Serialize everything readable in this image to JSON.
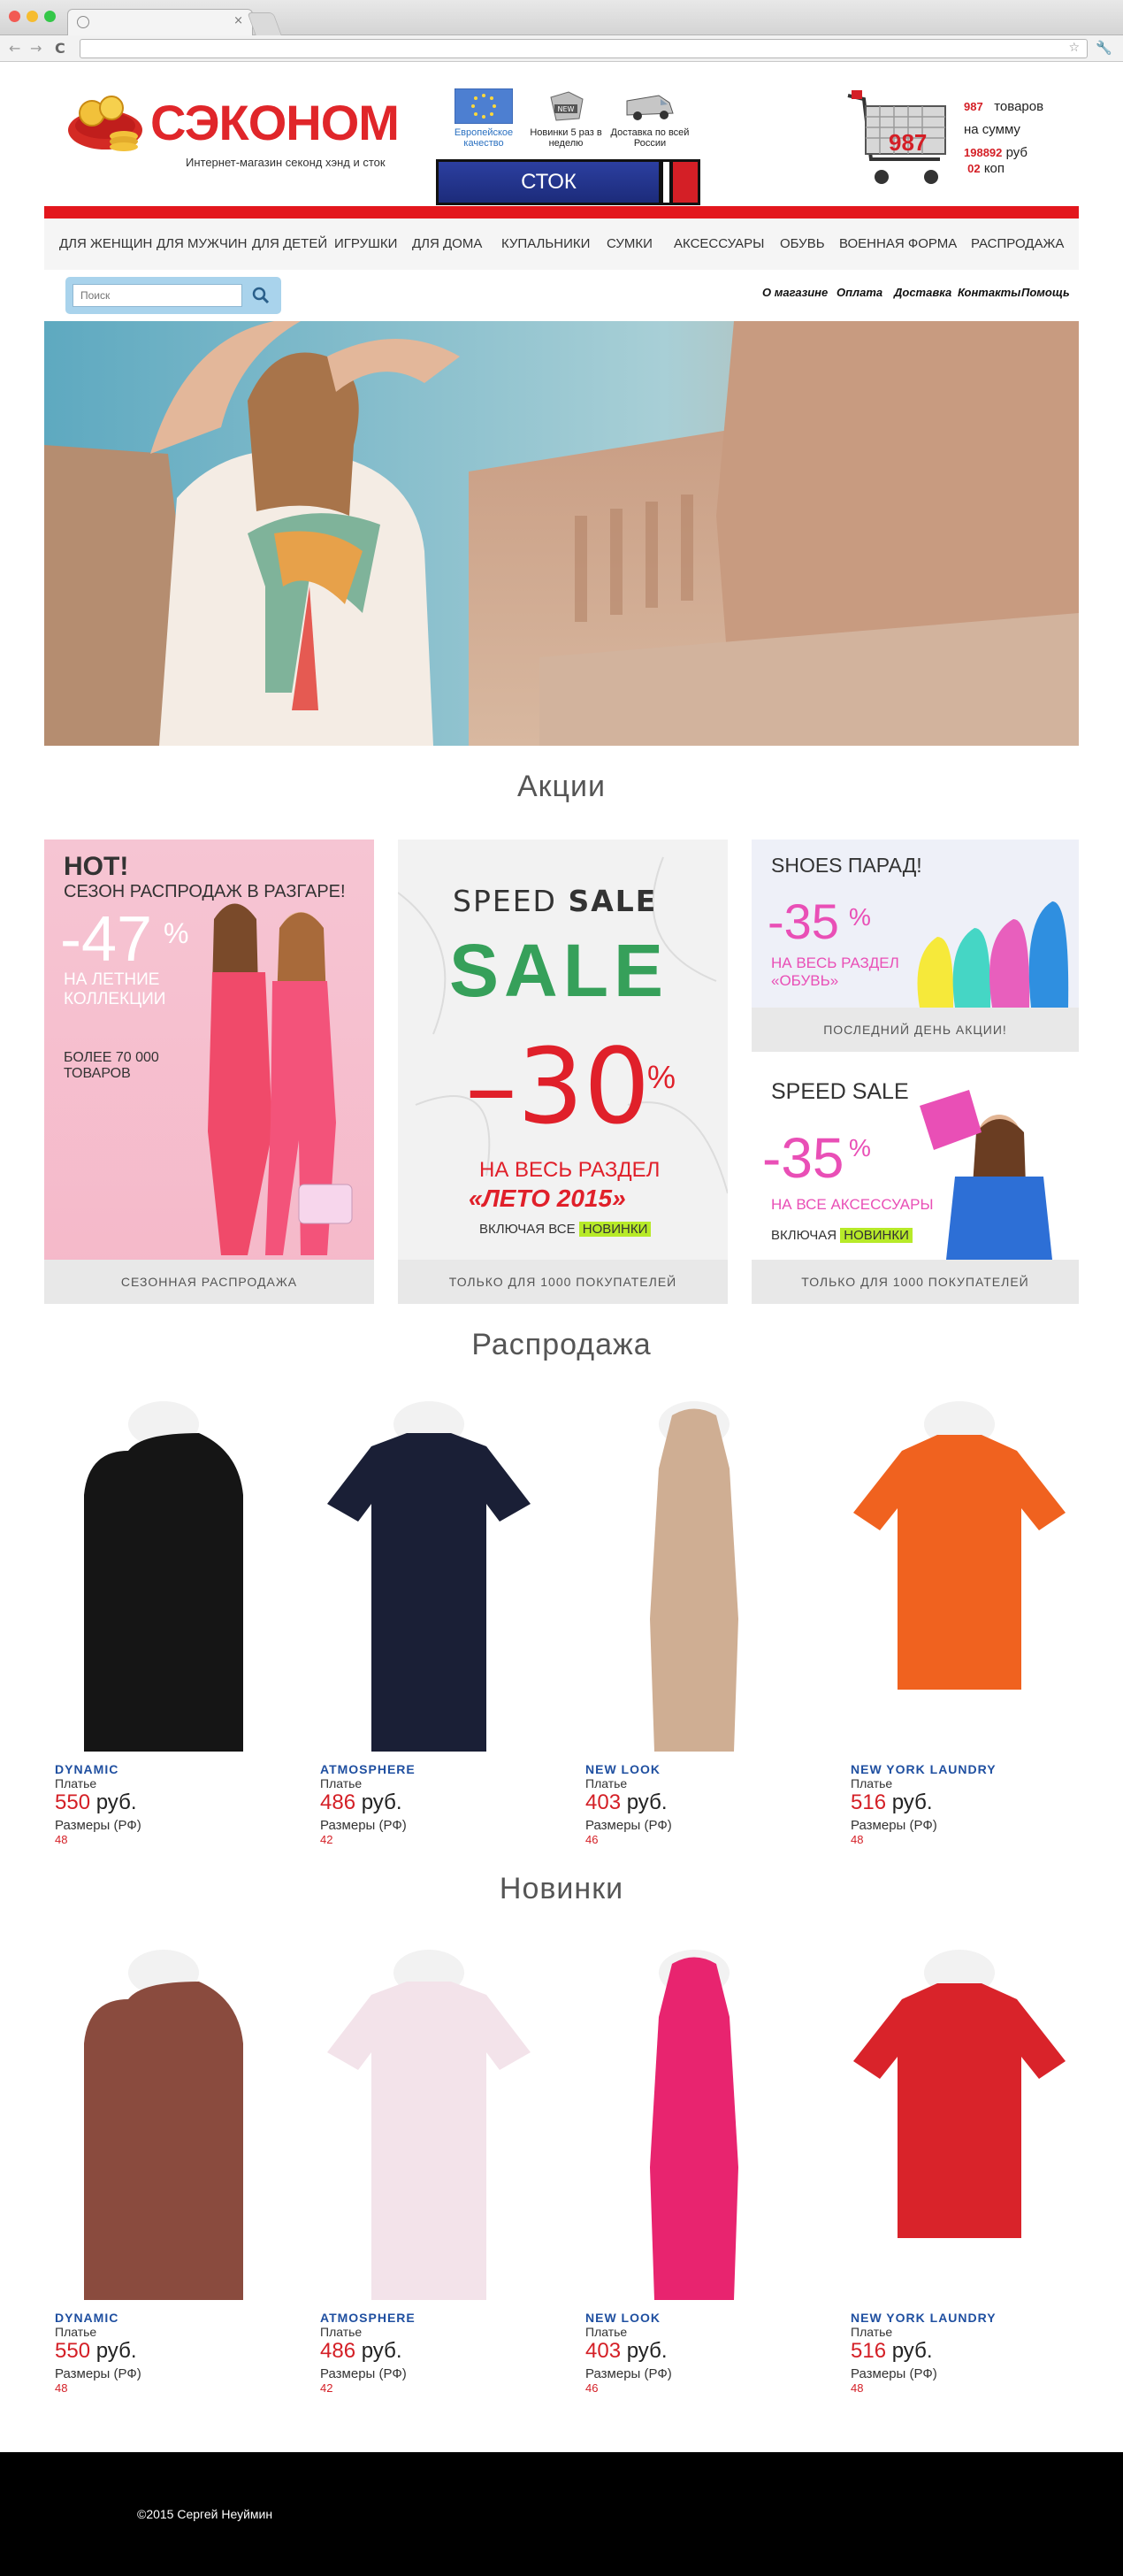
{
  "browser": {
    "tab_close": "×",
    "back": "←",
    "forward": "→",
    "reload": "C",
    "star": "☆",
    "wrench": "🔧"
  },
  "header": {
    "logo_text": "СЭКОНОМ",
    "logo_subtitle": "Интернет-магазин секонд хэнд и сток",
    "features": [
      {
        "label": "Европейское качество",
        "icon": "eu-flag-icon"
      },
      {
        "label": "Новинки 5 раз в неделю",
        "icon": "new-badge-icon"
      },
      {
        "label": "Доставка по всей России",
        "icon": "delivery-van-icon"
      }
    ],
    "stock_label": "СТОК",
    "cart": {
      "badge": "987",
      "count": "987",
      "count_label": "товаров",
      "sum_label": "на сумму",
      "rub": "198892",
      "rub_label": "руб",
      "kop": "02",
      "kop_label": "коп"
    }
  },
  "nav": {
    "items": [
      "ДЛЯ ЖЕНЩИН",
      "ДЛЯ МУЖЧИН",
      "ДЛЯ ДЕТЕЙ",
      "ИГРУШКИ",
      "ДЛЯ ДОМА",
      "КУПАЛЬНИКИ",
      "СУМКИ",
      "АКСЕССУАРЫ",
      "ОБУВЬ",
      "ВОЕННАЯ ФОРМА",
      "РАСПРОДАЖА"
    ]
  },
  "search": {
    "placeholder": "Поиск"
  },
  "top_links": [
    "О магазине",
    "Оплата",
    "Доставка",
    "Контакты",
    "Помощь"
  ],
  "sections": {
    "promos_title": "Акции",
    "sale_title": "Распродажа",
    "new_title": "Новинки"
  },
  "promos": [
    {
      "hot": "HOT!",
      "title": "СЕЗОН РАСПРОДАЖ В РАЗГАРЕ!",
      "discount": "-47",
      "percent": "%",
      "text": "НА ЛЕТНИЕ КОЛЛЕКЦИИ",
      "count": "БОЛЕЕ 70 000 ТОВАРОВ",
      "caption": "СЕЗОННАЯ РАСПРОДАЖА"
    },
    {
      "speed_a": "SPEED",
      "speed_b": "SALE",
      "big": "SALE",
      "discount": "–30",
      "percent": "%",
      "line1": "НА ВЕСЬ РАЗДЕЛ",
      "line2": "«ЛЕТО 2015»",
      "line3": "ВКЛЮЧАЯ ВСЕ",
      "highlight": "НОВИНКИ",
      "caption": "ТОЛЬКО ДЛЯ 1000 ПОКУПАТЕЛЕЙ"
    },
    {
      "title": "SHOES ПАРАД!",
      "discount": "-35",
      "percent": "%",
      "text": "НА ВЕСЬ РАЗДЕЛ «ОБУВЬ»",
      "caption": "ПОСЛЕДНИЙ ДЕНЬ АКЦИИ!"
    },
    {
      "title": "SPEED SALE",
      "discount": "-35",
      "percent": "%",
      "text": "НА ВСЕ АКСЕССУАРЫ",
      "line3": "ВКЛЮЧАЯ",
      "highlight": "НОВИНКИ",
      "caption": "ТОЛЬКО ДЛЯ 1000 ПОКУПАТЕЛЕЙ"
    }
  ],
  "sale_products": [
    {
      "brand": "DYNAMIC",
      "type": "Платье",
      "price": "550",
      "currency": "руб.",
      "sizes_label": "Размеры (РФ)",
      "size": "48",
      "color": "#151515"
    },
    {
      "brand": "ATMOSPHERE",
      "type": "Платье",
      "price": "486",
      "currency": "руб.",
      "sizes_label": "Размеры (РФ)",
      "size": "42",
      "color": "#1a1f36"
    },
    {
      "brand": "NEW LOOK",
      "type": "Платье",
      "price": "403",
      "currency": "руб.",
      "sizes_label": "Размеры (РФ)",
      "size": "46",
      "color": "#cfae93"
    },
    {
      "brand": "NEW YORK LAUNDRY",
      "type": "Платье",
      "price": "516",
      "currency": "руб.",
      "sizes_label": "Размеры (РФ)",
      "size": "48",
      "color": "#f0621f"
    }
  ],
  "new_products": [
    {
      "brand": "DYNAMIC",
      "type": "Платье",
      "price": "550",
      "currency": "руб.",
      "sizes_label": "Размеры (РФ)",
      "size": "48",
      "color": "#8a4b3e"
    },
    {
      "brand": "ATMOSPHERE",
      "type": "Платье",
      "price": "486",
      "currency": "руб.",
      "sizes_label": "Размеры (РФ)",
      "size": "42",
      "color": "#f3e3ea"
    },
    {
      "brand": "NEW LOOK",
      "type": "Платье",
      "price": "403",
      "currency": "руб.",
      "sizes_label": "Размеры (РФ)",
      "size": "46",
      "color": "#e8246f"
    },
    {
      "brand": "NEW YORK LAUNDRY",
      "type": "Платье",
      "price": "516",
      "currency": "руб.",
      "sizes_label": "Размеры (РФ)",
      "size": "48",
      "color": "#d9232a"
    }
  ],
  "footer": {
    "copyright": "©2015 Сергей Неуймин"
  },
  "colors": {
    "brand_red": "#e3171d",
    "brand_blue": "#1f4fa0",
    "stock_blue": "#2c3fa0"
  }
}
